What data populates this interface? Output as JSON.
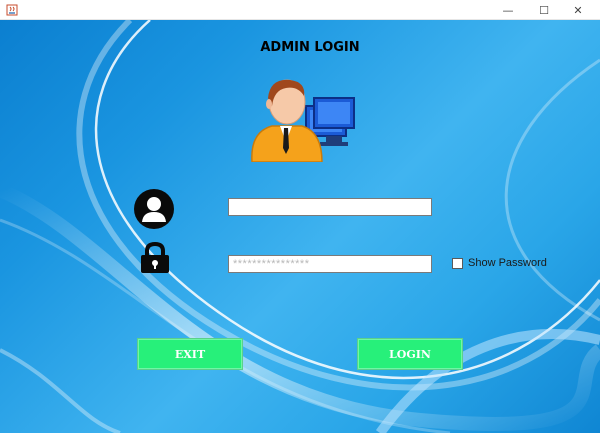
{
  "window": {
    "minimize_glyph": "—",
    "maximize_glyph": "☐",
    "close_glyph": "✕"
  },
  "header": {
    "title": "ADMIN LOGIN"
  },
  "form": {
    "username_icon": "user-circle-icon",
    "password_icon": "padlock-icon",
    "username_value": "",
    "password_placeholder": "****************",
    "show_password_label": "Show Password",
    "show_password_checked": false
  },
  "buttons": {
    "exit_label": "EXIT",
    "login_label": "LOGIN"
  },
  "colors": {
    "button_bg": "#27f07a",
    "button_text": "#ffffff",
    "background_primary": "#1a95e0"
  }
}
